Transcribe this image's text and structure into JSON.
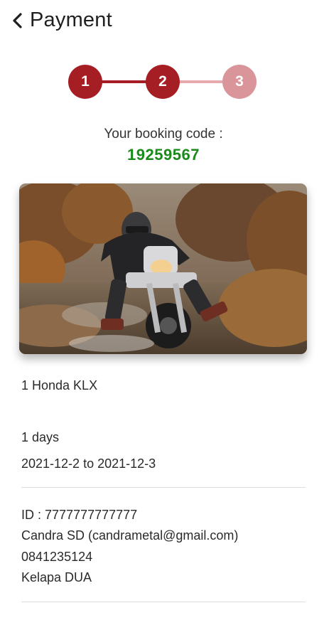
{
  "header": {
    "back_icon": "chevron-left-icon",
    "title": "Payment"
  },
  "stepper": {
    "steps": [
      "1",
      "2",
      "3"
    ],
    "current_step": 2,
    "colors": {
      "active": "#a51e24",
      "inactive": "#d9959a",
      "line_active": "#a51e24",
      "line_inactive": "#e6aaae"
    }
  },
  "booking": {
    "label": "Your booking code :",
    "code": "19259567",
    "code_color": "#1a8a1a"
  },
  "vehicle": {
    "image": "motorcycle-rider-photo",
    "name": "1 Honda KLX"
  },
  "rental": {
    "duration": "1 days",
    "dates": "2021-12-2 to 2021-12-3"
  },
  "customer": {
    "id": "ID : 7777777777777",
    "name_email": "Candra SD (candrametal@gmail.com)",
    "phone": "0841235124",
    "address": "Kelapa DUA"
  }
}
